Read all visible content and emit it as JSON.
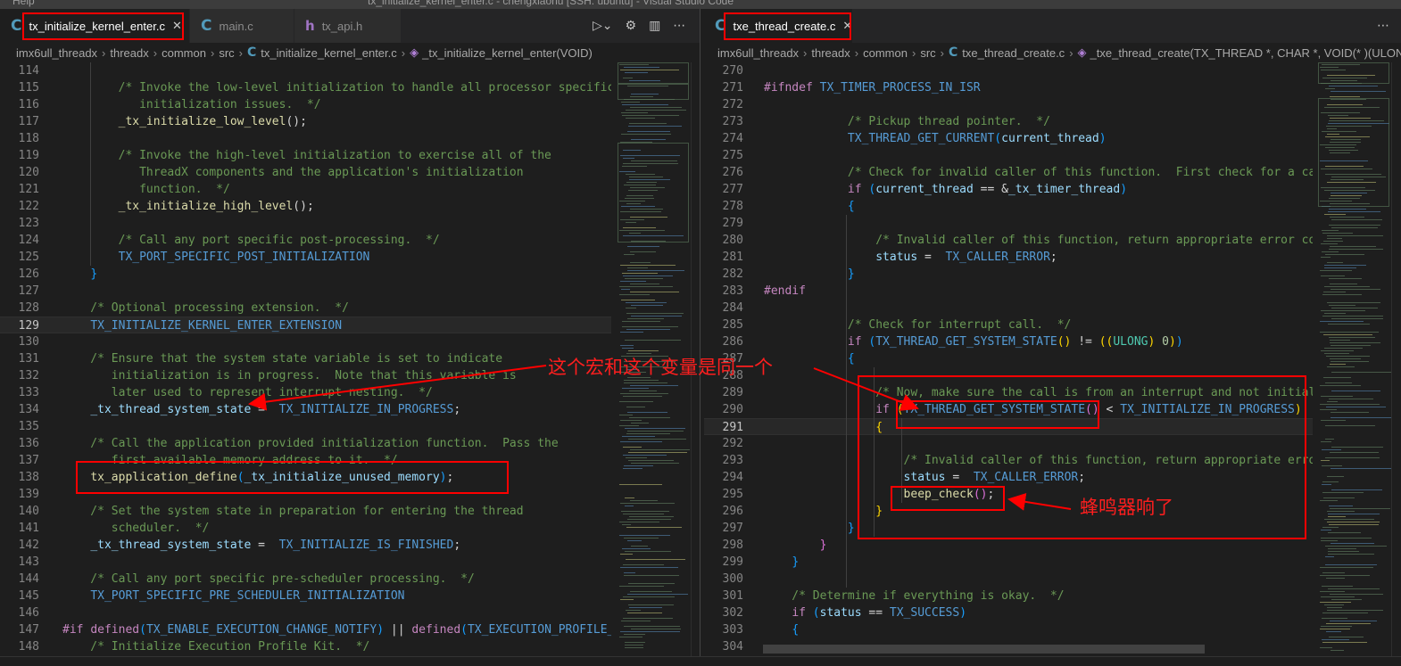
{
  "window": {
    "menu_item": "Help",
    "title": "tx_initialize_kernel_enter.c - chengxiaonu [SSH: ubuntu] - Visual Studio Code"
  },
  "left": {
    "tabs": [
      {
        "label": "tx_initialize_kernel_enter.c",
        "icon": "C",
        "close": "✕"
      },
      {
        "label": "main.c",
        "icon": "C"
      },
      {
        "label": "tx_api.h",
        "icon": "h"
      }
    ],
    "breadcrumb": [
      "imx6ull_threadx",
      "threadx",
      "common",
      "src",
      "tx_initialize_kernel_enter.c",
      "_tx_initialize_kernel_enter(VOID)"
    ],
    "lines": [
      {
        "n": "114",
        "segs": []
      },
      {
        "n": "115",
        "segs": [
          [
            "c",
            "        /* Invoke the low-level initialization to handle all processor specific"
          ]
        ]
      },
      {
        "n": "116",
        "segs": [
          [
            "c",
            "           initialization issues.  */"
          ]
        ]
      },
      {
        "n": "117",
        "segs": [
          [
            "p",
            "        "
          ],
          [
            "f",
            "_tx_initialize_low_level"
          ],
          [
            "p",
            "();"
          ]
        ]
      },
      {
        "n": "118",
        "segs": []
      },
      {
        "n": "119",
        "segs": [
          [
            "c",
            "        /* Invoke the high-level initialization to exercise all of the"
          ]
        ]
      },
      {
        "n": "120",
        "segs": [
          [
            "c",
            "           ThreadX components and the application's initialization"
          ]
        ]
      },
      {
        "n": "121",
        "segs": [
          [
            "c",
            "           function.  */"
          ]
        ]
      },
      {
        "n": "122",
        "segs": [
          [
            "p",
            "        "
          ],
          [
            "f",
            "_tx_initialize_high_level"
          ],
          [
            "p",
            "();"
          ]
        ]
      },
      {
        "n": "123",
        "segs": []
      },
      {
        "n": "124",
        "segs": [
          [
            "c",
            "        /* Call any port specific post-processing.  */"
          ]
        ]
      },
      {
        "n": "125",
        "segs": [
          [
            "p",
            "        "
          ],
          [
            "m",
            "TX_PORT_SPECIFIC_POST_INITIALIZATION"
          ]
        ]
      },
      {
        "n": "126",
        "segs": [
          [
            "p",
            "    "
          ],
          [
            "b",
            "}"
          ]
        ]
      },
      {
        "n": "127",
        "segs": []
      },
      {
        "n": "128",
        "segs": [
          [
            "c",
            "    /* Optional processing extension.  */"
          ]
        ]
      },
      {
        "n": "129",
        "segs": [
          [
            "p",
            "    "
          ],
          [
            "m",
            "TX_INITIALIZE_KERNEL_ENTER_EXTENSION"
          ]
        ]
      },
      {
        "n": "130",
        "segs": []
      },
      {
        "n": "131",
        "segs": [
          [
            "c",
            "    /* Ensure that the system state variable is set to indicate"
          ]
        ]
      },
      {
        "n": "132",
        "segs": [
          [
            "c",
            "       initialization is in progress.  Note that this variable is"
          ]
        ]
      },
      {
        "n": "133",
        "segs": [
          [
            "c",
            "       later used to represent interrupt nesting.  */"
          ]
        ]
      },
      {
        "n": "134",
        "segs": [
          [
            "p",
            "    "
          ],
          [
            "v",
            "_tx_thread_system_state"
          ],
          [
            "p",
            " =  "
          ],
          [
            "m",
            "TX_INITIALIZE_IN_PROGRESS"
          ],
          [
            "p",
            ";"
          ]
        ]
      },
      {
        "n": "135",
        "segs": []
      },
      {
        "n": "136",
        "segs": [
          [
            "c",
            "    /* Call the application provided initialization function.  Pass the"
          ]
        ]
      },
      {
        "n": "137",
        "segs": [
          [
            "c",
            "       first available memory address to it.  */"
          ]
        ]
      },
      {
        "n": "138",
        "segs": [
          [
            "p",
            "    "
          ],
          [
            "f",
            "tx_application_define"
          ],
          [
            "b",
            "("
          ],
          [
            "v",
            "_tx_initialize_unused_memory"
          ],
          [
            "b",
            ")"
          ],
          [
            "p",
            ";"
          ]
        ]
      },
      {
        "n": "139",
        "segs": []
      },
      {
        "n": "140",
        "segs": [
          [
            "c",
            "    /* Set the system state in preparation for entering the thread"
          ]
        ]
      },
      {
        "n": "141",
        "segs": [
          [
            "c",
            "       scheduler.  */"
          ]
        ]
      },
      {
        "n": "142",
        "segs": [
          [
            "p",
            "    "
          ],
          [
            "v",
            "_tx_thread_system_state"
          ],
          [
            "p",
            " =  "
          ],
          [
            "m",
            "TX_INITIALIZE_IS_FINISHED"
          ],
          [
            "p",
            ";"
          ]
        ]
      },
      {
        "n": "143",
        "segs": []
      },
      {
        "n": "144",
        "segs": [
          [
            "c",
            "    /* Call any port specific pre-scheduler processing.  */"
          ]
        ]
      },
      {
        "n": "145",
        "segs": [
          [
            "p",
            "    "
          ],
          [
            "m",
            "TX_PORT_SPECIFIC_PRE_SCHEDULER_INITIALIZATION"
          ]
        ]
      },
      {
        "n": "146",
        "segs": []
      },
      {
        "n": "147",
        "segs": [
          [
            "k",
            "#if"
          ],
          [
            "p",
            " "
          ],
          [
            "k",
            "defined"
          ],
          [
            "b",
            "("
          ],
          [
            "m",
            "TX_ENABLE_EXECUTION_CHANGE_NOTIFY"
          ],
          [
            "b",
            ")"
          ],
          [
            "p",
            " || "
          ],
          [
            "k",
            "defined"
          ],
          [
            "b",
            "("
          ],
          [
            "m",
            "TX_EXECUTION_PROFILE_ENABLE"
          ],
          [
            "b",
            ")"
          ]
        ]
      },
      {
        "n": "148",
        "segs": [
          [
            "c",
            "    /* Initialize Execution Profile Kit.  */"
          ]
        ]
      }
    ]
  },
  "right": {
    "tabs": [
      {
        "label": "txe_thread_create.c",
        "icon": "C",
        "close": "✕"
      }
    ],
    "breadcrumb": [
      "imx6ull_threadx",
      "threadx",
      "common",
      "src",
      "txe_thread_create.c",
      "_txe_thread_create(TX_THREAD *, CHAR *, VOID(* )(ULONG), ULONG, VOID *, ULONG, UINT, UINT, ULONG, UINT, UINT)"
    ],
    "lines": [
      {
        "n": "270",
        "segs": []
      },
      {
        "n": "271",
        "segs": [
          [
            "k",
            "#ifndef"
          ],
          [
            "p",
            " "
          ],
          [
            "m",
            "TX_TIMER_PROCESS_IN_ISR"
          ]
        ]
      },
      {
        "n": "272",
        "segs": []
      },
      {
        "n": "273",
        "segs": [
          [
            "c",
            "            /* Pickup thread pointer.  */"
          ]
        ]
      },
      {
        "n": "274",
        "segs": [
          [
            "p",
            "            "
          ],
          [
            "m",
            "TX_THREAD_GET_CURRENT"
          ],
          [
            "b",
            "("
          ],
          [
            "v",
            "current_thread"
          ],
          [
            "b",
            ")"
          ]
        ]
      },
      {
        "n": "275",
        "segs": []
      },
      {
        "n": "276",
        "segs": [
          [
            "c",
            "            /* Check for invalid caller of this function.  First check for a calling thread.  */"
          ]
        ]
      },
      {
        "n": "277",
        "segs": [
          [
            "p",
            "            "
          ],
          [
            "k",
            "if"
          ],
          [
            "p",
            " "
          ],
          [
            "b",
            "("
          ],
          [
            "v",
            "current_thread"
          ],
          [
            "p",
            " == &"
          ],
          [
            "v",
            "_tx_timer_thread"
          ],
          [
            "b",
            ")"
          ]
        ]
      },
      {
        "n": "278",
        "segs": [
          [
            "p",
            "            "
          ],
          [
            "b",
            "{"
          ]
        ]
      },
      {
        "n": "279",
        "segs": []
      },
      {
        "n": "280",
        "segs": [
          [
            "c",
            "                /* Invalid caller of this function, return appropriate error code.  */"
          ]
        ]
      },
      {
        "n": "281",
        "segs": [
          [
            "p",
            "                "
          ],
          [
            "v",
            "status"
          ],
          [
            "p",
            " =  "
          ],
          [
            "m",
            "TX_CALLER_ERROR"
          ],
          [
            "p",
            ";"
          ]
        ]
      },
      {
        "n": "282",
        "segs": [
          [
            "p",
            "            "
          ],
          [
            "b",
            "}"
          ]
        ]
      },
      {
        "n": "283",
        "segs": [
          [
            "k",
            "#endif"
          ]
        ]
      },
      {
        "n": "284",
        "segs": []
      },
      {
        "n": "285",
        "segs": [
          [
            "c",
            "            /* Check for interrupt call.  */"
          ]
        ]
      },
      {
        "n": "286",
        "segs": [
          [
            "p",
            "            "
          ],
          [
            "k",
            "if"
          ],
          [
            "p",
            " "
          ],
          [
            "b",
            "("
          ],
          [
            "m",
            "TX_THREAD_GET_SYSTEM_STATE"
          ],
          [
            "y",
            "()"
          ],
          [
            "p",
            " != "
          ],
          [
            "y",
            "(("
          ],
          [
            "t",
            "ULONG"
          ],
          [
            "y",
            ")"
          ],
          [
            "p",
            " "
          ],
          [
            "n",
            "0"
          ],
          [
            "y",
            ")"
          ],
          [
            "b",
            ")"
          ]
        ]
      },
      {
        "n": "287",
        "segs": [
          [
            "p",
            "            "
          ],
          [
            "b",
            "{"
          ]
        ]
      },
      {
        "n": "288",
        "segs": []
      },
      {
        "n": "289",
        "segs": [
          [
            "c",
            "                /* Now, make sure the call is from an interrupt and not initialization.  */"
          ]
        ]
      },
      {
        "n": "290",
        "segs": [
          [
            "p",
            "                "
          ],
          [
            "k",
            "if"
          ],
          [
            "p",
            " "
          ],
          [
            "y",
            "("
          ],
          [
            "m",
            "TX_THREAD_GET_SYSTEM_STATE"
          ],
          [
            "g",
            "()"
          ],
          [
            "p",
            " < "
          ],
          [
            "m",
            "TX_INITIALIZE_IN_PROGRESS"
          ],
          [
            "y",
            ")"
          ]
        ]
      },
      {
        "n": "291",
        "segs": [
          [
            "p",
            "                "
          ],
          [
            "y",
            "{"
          ]
        ]
      },
      {
        "n": "292",
        "segs": []
      },
      {
        "n": "293",
        "segs": [
          [
            "c",
            "                    /* Invalid caller of this function, return appropriate error code.  */"
          ]
        ]
      },
      {
        "n": "294",
        "segs": [
          [
            "p",
            "                    "
          ],
          [
            "v",
            "status"
          ],
          [
            "p",
            " =  "
          ],
          [
            "m",
            "TX_CALLER_ERROR"
          ],
          [
            "p",
            ";"
          ]
        ]
      },
      {
        "n": "295",
        "segs": [
          [
            "p",
            "                    "
          ],
          [
            "f",
            "beep_check"
          ],
          [
            "g",
            "()"
          ],
          [
            "p",
            ";"
          ]
        ]
      },
      {
        "n": "296",
        "segs": [
          [
            "p",
            "                "
          ],
          [
            "y",
            "}"
          ]
        ]
      },
      {
        "n": "297",
        "segs": [
          [
            "p",
            "            "
          ],
          [
            "b",
            "}"
          ]
        ]
      },
      {
        "n": "298",
        "segs": [
          [
            "p",
            "        "
          ],
          [
            "o",
            "}"
          ]
        ]
      },
      {
        "n": "299",
        "segs": [
          [
            "p",
            "    "
          ],
          [
            "b",
            "}"
          ]
        ]
      },
      {
        "n": "300",
        "segs": []
      },
      {
        "n": "301",
        "segs": [
          [
            "c",
            "    /* Determine if everything is okay.  */"
          ]
        ]
      },
      {
        "n": "302",
        "segs": [
          [
            "p",
            "    "
          ],
          [
            "k",
            "if"
          ],
          [
            "p",
            " "
          ],
          [
            "b",
            "("
          ],
          [
            "v",
            "status"
          ],
          [
            "p",
            " == "
          ],
          [
            "m",
            "TX_SUCCESS"
          ],
          [
            "b",
            ")"
          ]
        ]
      },
      {
        "n": "303",
        "segs": [
          [
            "p",
            "    "
          ],
          [
            "b",
            "{"
          ]
        ]
      },
      {
        "n": "304",
        "segs": []
      }
    ]
  },
  "annotations": {
    "macro_note": "这个宏和这个变量是同一个",
    "beep_note": "蜂鸣器响了"
  },
  "colors": {
    "comment": "#6a9955",
    "keyword": "#c586c0",
    "macro": "#569cd6",
    "function": "#dcdcaa",
    "variable": "#9cdcfe",
    "type": "#4ec9b0",
    "number": "#b5cea8",
    "plain": "#d4d4d4",
    "bracket_blue": "#179fff",
    "bracket_yellow": "#ffd700",
    "bracket_orange": "#da70d6",
    "highlight": "#ff0000"
  },
  "active_lines": {
    "left": "129",
    "right": "291"
  }
}
